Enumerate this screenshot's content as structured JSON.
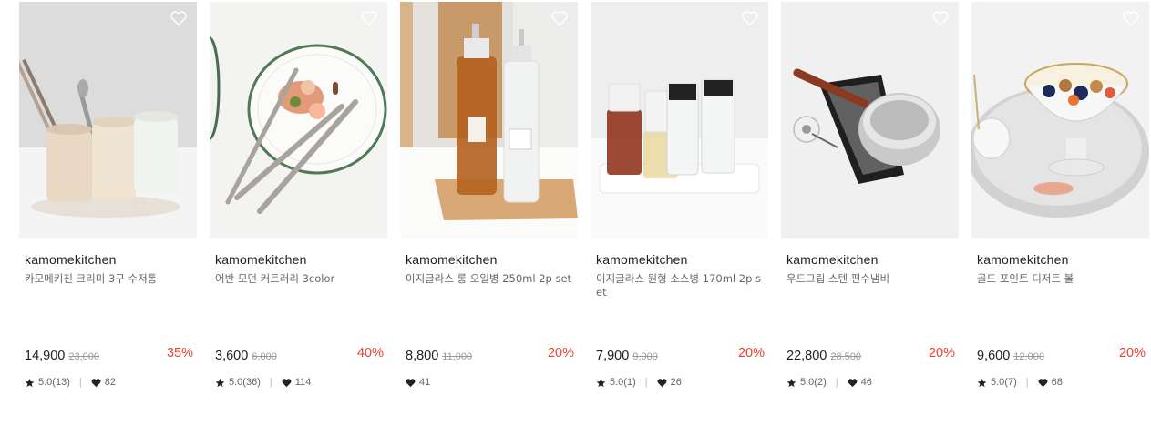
{
  "colors": {
    "discount": "#e8432c",
    "text": "#222222",
    "muted": "#999999"
  },
  "products": [
    {
      "brand": "kamomekitchen",
      "name": "카모메키친 크리미 3구 수저통",
      "price": "14,900",
      "original_price": "23,000",
      "discount": "35%",
      "rating": "5.0(13)",
      "likes": "82",
      "image": "utensil-holders"
    },
    {
      "brand": "kamomekitchen",
      "name": "어반 모던 커트러리 3color",
      "price": "3,600",
      "original_price": "6,000",
      "discount": "40%",
      "rating": "5.0(36)",
      "likes": "114",
      "image": "cutlery-plate"
    },
    {
      "brand": "kamomekitchen",
      "name": "이지글라스 롱 오일병 250ml 2p set",
      "price": "8,800",
      "original_price": "11,000",
      "discount": "20%",
      "rating": "",
      "likes": "41",
      "image": "oil-bottles"
    },
    {
      "brand": "kamomekitchen",
      "name": "이지글라스 원형 소스병 170ml 2p set",
      "price": "7,900",
      "original_price": "9,900",
      "discount": "20%",
      "rating": "5.0(1)",
      "likes": "26",
      "image": "sauce-bottles"
    },
    {
      "brand": "kamomekitchen",
      "name": "우드그립 스텐 편수냄비",
      "price": "22,800",
      "original_price": "28,500",
      "discount": "20%",
      "rating": "5.0(2)",
      "likes": "46",
      "image": "saucepan"
    },
    {
      "brand": "kamomekitchen",
      "name": "골드 포인트 디저트 볼",
      "price": "9,600",
      "original_price": "12,000",
      "discount": "20%",
      "rating": "5.0(7)",
      "likes": "68",
      "image": "dessert-bowl"
    }
  ]
}
